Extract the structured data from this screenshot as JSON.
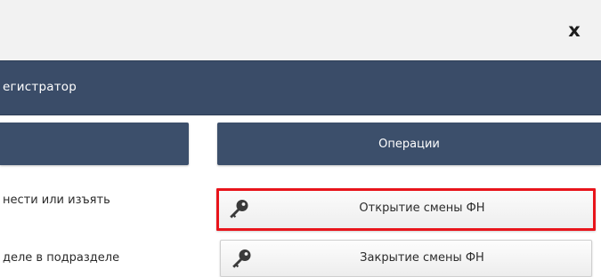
{
  "window": {
    "close_label": "x",
    "title": "егистратор"
  },
  "columns": {
    "left_header": "",
    "right_header": "Операции"
  },
  "left_list": [
    "нести или изъять",
    "деле в подразделе"
  ],
  "operations": [
    {
      "label": "Открытие смены ФН",
      "icon": "key-icon",
      "highlighted": true
    },
    {
      "label": "Закрытие смены ФН",
      "icon": "key-icon",
      "highlighted": false
    }
  ],
  "colors": {
    "header_bg": "#3a4c68",
    "highlight_border": "#e8141b",
    "key_icon": "#3a3a3a"
  }
}
